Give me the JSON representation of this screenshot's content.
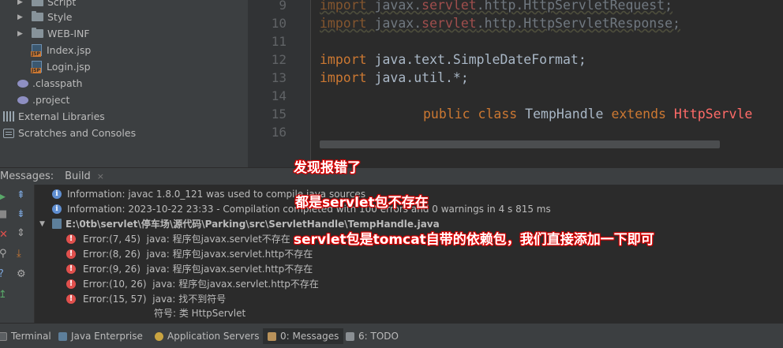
{
  "project_tree": {
    "items": [
      {
        "label": "Script",
        "type": "folder"
      },
      {
        "label": "Style",
        "type": "folder"
      },
      {
        "label": "WEB-INF",
        "type": "folder"
      },
      {
        "label": "Index.jsp",
        "type": "jsp"
      },
      {
        "label": "Login.jsp",
        "type": "jsp"
      },
      {
        "label": ".classpath",
        "type": "config"
      },
      {
        "label": ".project",
        "type": "config"
      },
      {
        "label": "External Libraries",
        "type": "library"
      },
      {
        "label": "Scratches and Consoles",
        "type": "scratch"
      }
    ]
  },
  "editor": {
    "line_numbers": [
      "9",
      "10",
      "11",
      "12",
      "13",
      "14",
      "15",
      "16"
    ],
    "lines": {
      "l9_kw": "import",
      "l9_a": " javax.",
      "l9_b": "servlet",
      "l9_c": ".http.HttpServletRequest;",
      "l10_kw": "import",
      "l10_a": " javax.",
      "l10_b": "servlet",
      "l10_c": ".http.HttpServletResponse;",
      "l12_kw": "import",
      "l12_rest": " java.text.SimpleDateFormat;",
      "l13_kw": "import",
      "l13_rest": " java.util.*;",
      "l15_kw1": "public class",
      "l15_name": " TempHandle ",
      "l15_kw2": "extends",
      "l15_parent": " HttpServle"
    }
  },
  "messages_panel": {
    "title": "Messages:",
    "tab": "Build",
    "close": "×",
    "info": [
      "Information: javac 1.8.0_121 was used to compile java sources",
      "Information: 2023-10-22 23:33 - Compilation completed with 100 errors and 0 warnings in 4 s 815 ms"
    ],
    "file_path": "E:\\0tb\\servlet\\停车场\\源代码\\Parking\\src\\ServletHandle\\TempHandle.java",
    "errors": [
      {
        "pos": "Error:(7, 45)",
        "text": "java: 程序包javax.servlet不存在"
      },
      {
        "pos": "Error:(8, 26)",
        "text": "java: 程序包javax.servlet.http不存在"
      },
      {
        "pos": "Error:(9, 26)",
        "text": "java: 程序包javax.servlet.http不存在"
      },
      {
        "pos": "Error:(10, 26)",
        "text": "java: 程序包javax.servlet.http不存在"
      },
      {
        "pos": "Error:(15, 57)",
        "text": "java: 找不到符号"
      }
    ],
    "symbol_line": "符号: 类 HttpServlet"
  },
  "bottom_bar": {
    "tabs": [
      {
        "label": "Terminal"
      },
      {
        "label": "Java Enterprise"
      },
      {
        "label": "Application Servers"
      },
      {
        "label": "0: Messages"
      },
      {
        "label": "6: TODO"
      }
    ]
  },
  "annotations": {
    "note1": "发现报错了",
    "note2": "都是servlet包不存在",
    "note3": "servlet包是tomcat自带的依赖包，我们直接添加一下即可"
  },
  "colors": {
    "error_red": "#e0504d",
    "info_blue": "#5f8ed1",
    "keyword": "#cc7832",
    "annotation_outline": "#dd0000"
  }
}
